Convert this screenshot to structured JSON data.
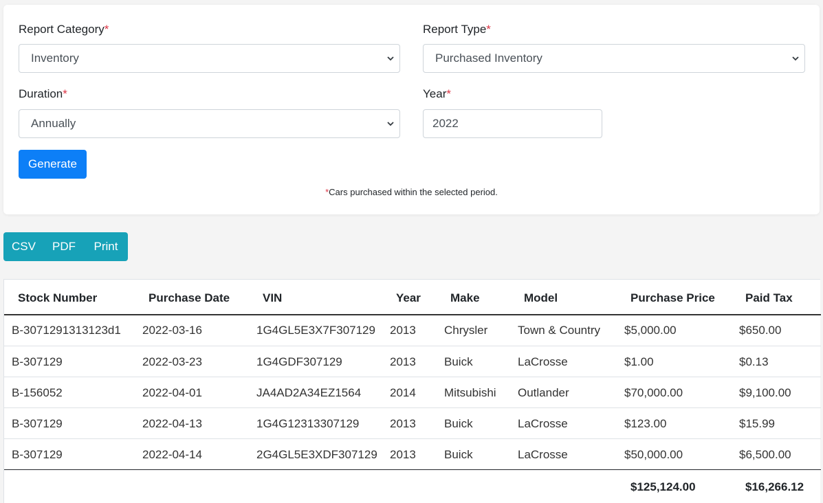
{
  "form": {
    "report_category": {
      "label": "Report Category",
      "required": "*",
      "value": "Inventory"
    },
    "report_type": {
      "label": "Report Type",
      "required": "*",
      "value": "Purchased Inventory"
    },
    "duration": {
      "label": "Duration",
      "required": "*",
      "value": "Annually"
    },
    "year": {
      "label": "Year",
      "required": "*",
      "value": "2022"
    },
    "generate_label": "Generate",
    "note_star": "*",
    "note_text": "Cars purchased within the selected period."
  },
  "export": {
    "csv": "CSV",
    "pdf": "PDF",
    "print": "Print"
  },
  "table": {
    "headers": [
      "Stock Number",
      "Purchase Date",
      "VIN",
      "Year",
      "Make",
      "Model",
      "Purchase Price",
      "Paid Tax"
    ],
    "rows": [
      [
        "B-3071291313123d1",
        "2022-03-16",
        "1G4GL5E3X7F307129",
        "2013",
        "Chrysler",
        "Town & Country",
        "$5,000.00",
        "$650.00"
      ],
      [
        "B-307129",
        "2022-03-23",
        "1G4GDF307129",
        "2013",
        "Buick",
        "LaCrosse",
        "$1.00",
        "$0.13"
      ],
      [
        "B-156052",
        "2022-04-01",
        "JA4AD2A34EZ1564",
        "2014",
        "Mitsubishi",
        "Outlander",
        "$70,000.00",
        "$9,100.00"
      ],
      [
        "B-307129",
        "2022-04-13",
        "1G4G12313307129",
        "2013",
        "Buick",
        "LaCrosse",
        "$123.00",
        "$15.99"
      ],
      [
        "B-307129",
        "2022-04-14",
        "2G4GL5E3XDF307129",
        "2013",
        "Buick",
        "LaCrosse",
        "$50,000.00",
        "$6,500.00"
      ]
    ],
    "totals": {
      "purchase_price": "$125,124.00",
      "paid_tax": "$16,266.12"
    }
  },
  "colors": {
    "primary": "#0d7ff7",
    "info": "#17a2b8",
    "required": "#dc3545"
  }
}
